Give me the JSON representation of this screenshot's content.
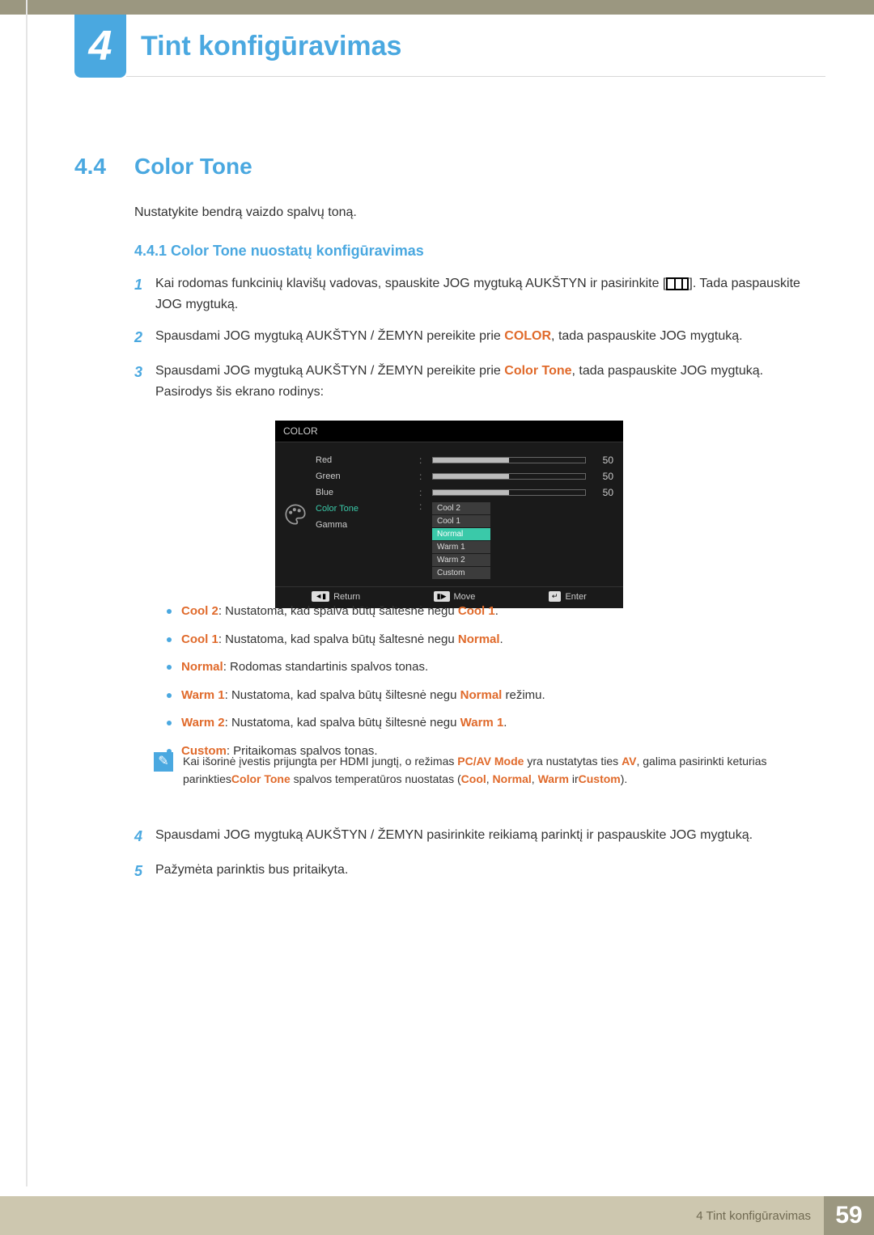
{
  "chapter": {
    "num": "4",
    "title": "Tint  konfigūravimas"
  },
  "section": {
    "num": "4.4",
    "title": "Color Tone"
  },
  "intro": "Nustatykite bendrą vaizdo spalvų toną.",
  "subsection": "4.4.1  Color Tone nuostatų konfigūravimas",
  "steps": {
    "s1": {
      "num": "1",
      "a": "Kai rodomas funkcinių klavišų vadovas, spauskite JOG mygtuką AUKŠTYN ir pasirinkite [",
      "b": "]. Tada paspauskite JOG mygtuką."
    },
    "s2": {
      "num": "2",
      "a": "Spausdami JOG mygtuką AUKŠTYN / ŽEMYN pereikite prie ",
      "hl": "COLOR",
      "b": ", tada paspauskite JOG mygtuką."
    },
    "s3": {
      "num": "3",
      "a": "Spausdami JOG mygtuką AUKŠTYN / ŽEMYN pereikite prie ",
      "hl": "Color Tone",
      "b": ", tada paspauskite JOG mygtuką. Pasirodys šis ekrano rodinys:"
    },
    "s4": {
      "num": "4",
      "text": "Spausdami JOG mygtuką AUKŠTYN / ŽEMYN pasirinkite reikiamą parinktį ir paspauskite JOG mygtuką."
    },
    "s5": {
      "num": "5",
      "text": "Pažymėta parinktis bus pritaikyta."
    }
  },
  "osd": {
    "title": "COLOR",
    "labels": {
      "red": "Red",
      "green": "Green",
      "blue": "Blue",
      "colortone": "Color Tone",
      "gamma": "Gamma"
    },
    "values": {
      "red": "50",
      "green": "50",
      "blue": "50"
    },
    "options": {
      "o1": "Cool 2",
      "o2": "Cool 1",
      "o3": "Normal",
      "o4": "Warm 1",
      "o5": "Warm 2",
      "o6": "Custom"
    },
    "footer": {
      "return": "Return",
      "move": "Move",
      "enter": "Enter"
    }
  },
  "bullets": {
    "b1": {
      "hl1": "Cool 2",
      "t1": ": Nustatoma, kad spalva būtų šaltesnė negu ",
      "hl2": "Cool 1",
      "t2": "."
    },
    "b2": {
      "hl1": "Cool 1",
      "t1": ": Nustatoma, kad spalva būtų šaltesnė negu ",
      "hl2": "Normal",
      "t2": "."
    },
    "b3": {
      "hl1": "Normal",
      "t1": ": Rodomas standartinis spalvos tonas."
    },
    "b4": {
      "hl1": "Warm 1",
      "t1": ": Nustatoma, kad spalva būtų šiltesnė negu ",
      "hl2": "Normal",
      "t2": " režimu."
    },
    "b5": {
      "hl1": "Warm 2",
      "t1": ": Nustatoma, kad spalva būtų šiltesnė negu ",
      "hl2": "Warm 1",
      "t2": "."
    },
    "b6": {
      "hl1": "Custom",
      "t1": ": Pritaikomas spalvos tonas."
    }
  },
  "note": {
    "a": "Kai išorinė įvestis prijungta per HDMI jungtį, o režimas ",
    "hl1": "PC/AV Mode",
    "b": " yra nustatytas ties ",
    "hl2": "AV",
    "c": ", galima pasirinkti keturias parinkties",
    "hl3": "Color Tone",
    "d": " spalvos temperatūros nuostatas (",
    "hl4": "Cool",
    "sep1": ", ",
    "hl5": "Normal",
    "sep2": ", ",
    "hl6": "Warm",
    "e": " ir",
    "hl7": "Custom",
    "f": ")."
  },
  "footer": {
    "label": "4 Tint  konfigūravimas",
    "page": "59"
  }
}
